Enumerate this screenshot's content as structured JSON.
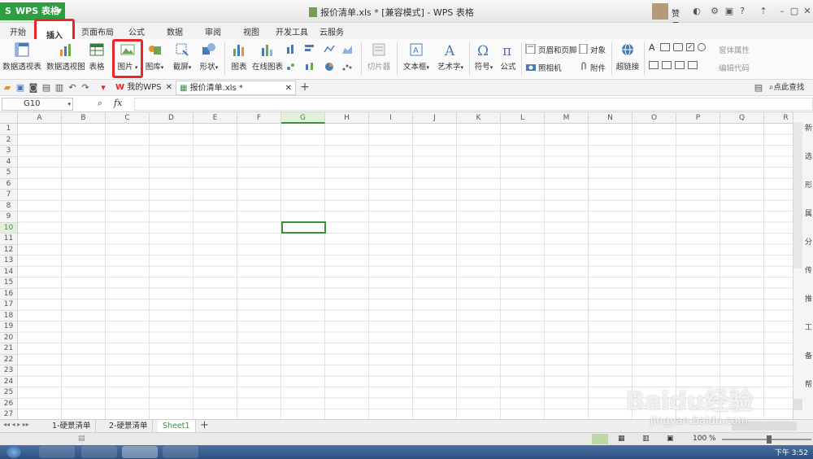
{
  "app": {
    "name": "WPS 表格",
    "window_title": "报价清单.xls * [兼容模式] - WPS 表格",
    "user": "赞子"
  },
  "menu": {
    "tabs": [
      "开始",
      "插入",
      "页面布局",
      "公式",
      "数据",
      "审阅",
      "视图",
      "开发工具",
      "云服务"
    ],
    "active": "插入"
  },
  "ribbon": {
    "pivot_table": "数据透视表",
    "pivot_chart": "数据透视图",
    "table": "表格",
    "picture": "图片",
    "gallery": "图库",
    "screenshot": "截屏",
    "shapes": "形状",
    "chart": "图表",
    "online_chart": "在线图表",
    "slicer": "切片器",
    "textbox": "文本框",
    "wordart": "艺术字",
    "symbol": "符号",
    "formula": "公式",
    "header_footer": "页眉和页脚",
    "object": "对象",
    "camera": "照相机",
    "attachment": "附件",
    "hyperlink": "超链接",
    "form_props": "窗体属性",
    "edit_code": "编辑代码"
  },
  "doctabs": {
    "my_wps": "我的WPS",
    "file": "报价清单.xls *",
    "search": "点此查找"
  },
  "formula_bar": {
    "name_box": "G10",
    "fx": "fx",
    "value": ""
  },
  "grid": {
    "columns": [
      "A",
      "B",
      "C",
      "D",
      "E",
      "F",
      "G",
      "H",
      "I",
      "J",
      "K",
      "L",
      "M",
      "N",
      "O",
      "P",
      "Q",
      "R"
    ],
    "rows": [
      "1",
      "2",
      "3",
      "4",
      "5",
      "6",
      "7",
      "8",
      "9",
      "10",
      "11",
      "12",
      "13",
      "14",
      "15",
      "16",
      "17",
      "18",
      "19",
      "20",
      "21",
      "22",
      "23",
      "24",
      "25",
      "26",
      "27"
    ],
    "selected_column": "G",
    "selected_row": "10"
  },
  "right_pane": [
    "新",
    "选",
    "形",
    "属",
    "分",
    "传",
    "推",
    "工",
    "备",
    "帮"
  ],
  "sheets": {
    "tabs": [
      "1-硬景清单",
      "2-硬景清单",
      "Sheet1"
    ],
    "active": "Sheet1"
  },
  "status": {
    "zoom": "100 %"
  },
  "taskbar": {
    "clock": "下午 3:52"
  },
  "watermark": {
    "text": "Baidu经验",
    "url": "jingyan.baidu.com"
  },
  "colors": {
    "accent_green": "#2e9e43",
    "highlight_red": "#e8262a",
    "selection": "#3d8f3d"
  }
}
